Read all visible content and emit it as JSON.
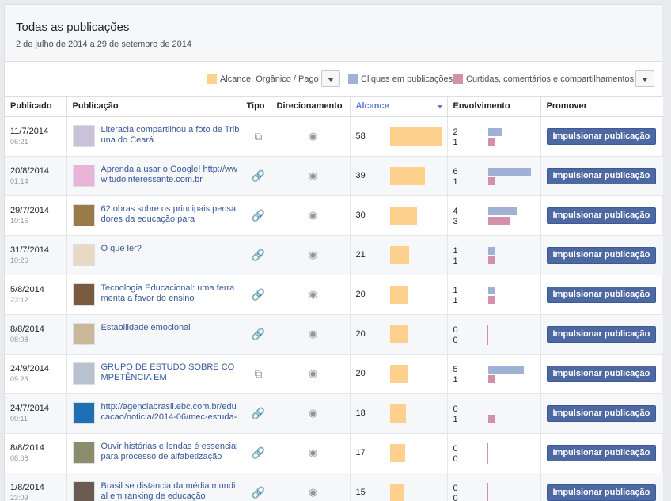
{
  "header": {
    "title": "Todas as publicações",
    "range": "2 de julho de 2014 a 29 de setembro de 2014"
  },
  "legend": {
    "reach_label": "Alcance: Orgânico / Pago",
    "clicks_label": "Cliques em publicações",
    "reactions_label": "Curtidas, comentários e compartilhamentos",
    "colors": {
      "reach": "#fdd08e",
      "clicks": "#9fb1d4",
      "reactions": "#d48faa"
    }
  },
  "columns": {
    "published": "Publicado",
    "post": "Publicação",
    "type": "Tipo",
    "targeting": "Direcionamento",
    "reach": "Alcance",
    "engagement": "Envolvimento",
    "promote": "Promover"
  },
  "boost_label": "Impulsionar publicação",
  "rows": [
    {
      "date": "11/7/2014",
      "time": "06:21",
      "text": "Literacia compartilhou a foto de Tribuna do Ceará.",
      "type": "photo-icon",
      "reach": 58,
      "clicks": 2,
      "reactions": 1,
      "thumb": "#c9c2d9"
    },
    {
      "date": "20/8/2014",
      "time": "01:14",
      "text": "Aprenda a usar o Google! http://www.tudointeressante.com.br",
      "type": "link-icon",
      "reach": 39,
      "clicks": 6,
      "reactions": 1,
      "thumb": "#e7b3d6"
    },
    {
      "date": "29/7/2014",
      "time": "10:16",
      "text": "62 obras sobre os principais pensadores da educação para",
      "type": "link-icon",
      "reach": 30,
      "clicks": 4,
      "reactions": 3,
      "thumb": "#9b7a4a"
    },
    {
      "date": "31/7/2014",
      "time": "10:26",
      "text": "O que ler?",
      "type": "link-icon",
      "reach": 21,
      "clicks": 1,
      "reactions": 1,
      "thumb": "#e8d9c5"
    },
    {
      "date": "5/8/2014",
      "time": "23:12",
      "text": "Tecnologia Educacional: uma ferramenta a favor do ensino",
      "type": "link-icon",
      "reach": 20,
      "clicks": 1,
      "reactions": 1,
      "thumb": "#7a5a3e"
    },
    {
      "date": "8/8/2014",
      "time": "08:08",
      "text": "Estabilidade emocional",
      "type": "link-icon",
      "reach": 20,
      "clicks": 0,
      "reactions": 0,
      "thumb": "#c8b898"
    },
    {
      "date": "24/9/2014",
      "time": "09:25",
      "text": "GRUPO DE ESTUDO SOBRE COMPETÊNCIA EM",
      "type": "photo-icon",
      "reach": 20,
      "clicks": 5,
      "reactions": 1,
      "thumb": "#b9c3cf"
    },
    {
      "date": "24/7/2014",
      "time": "09:11",
      "text": "http://agenciabrasil.ebc.com.br/educacao/noticia/2014-06/mec-estuda-",
      "type": "link-icon",
      "reach": 18,
      "clicks": 0,
      "reactions": 1,
      "thumb": "#1f6fb5"
    },
    {
      "date": "8/8/2014",
      "time": "08:08",
      "text": "Ouvir histórias e lendas é essencial para processo de alfabetização",
      "type": "link-icon",
      "reach": 17,
      "clicks": 0,
      "reactions": 0,
      "thumb": "#8a8c6a"
    },
    {
      "date": "1/8/2014",
      "time": "23:09",
      "text": "Brasil se distancia da média mundial em ranking de educação",
      "type": "link-icon",
      "reach": 15,
      "clicks": 0,
      "reactions": 0,
      "thumb": "#6b5a52"
    }
  ],
  "scale": {
    "reach_max": 58,
    "eng_max": 6
  }
}
